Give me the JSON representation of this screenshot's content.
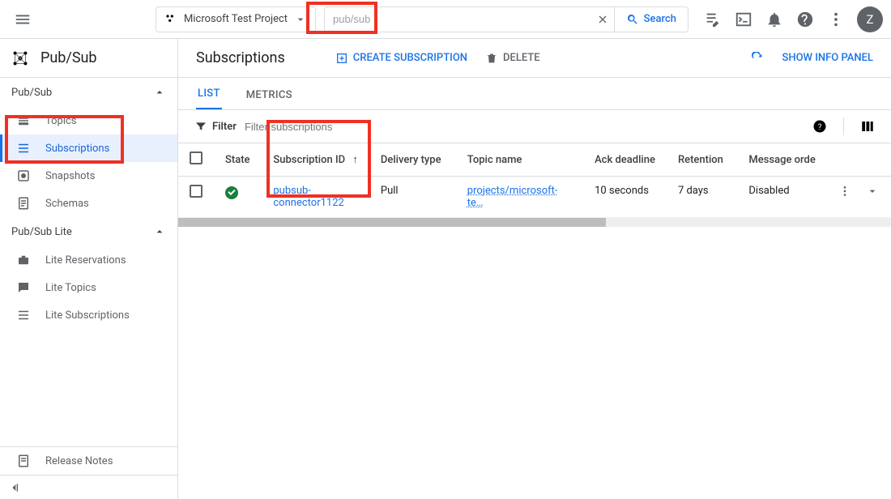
{
  "topbar": {
    "project_name": "Microsoft Test Project",
    "search_value": "pub/sub",
    "search_button": "Search",
    "avatar_initial": "Z"
  },
  "sidebar": {
    "product_title": "Pub/Sub",
    "sections": {
      "pubsub": {
        "label": "Pub/Sub"
      },
      "pubsub_lite": {
        "label": "Pub/Sub Lite"
      }
    },
    "items": {
      "topics": "Topics",
      "subscriptions": "Subscriptions",
      "snapshots": "Snapshots",
      "schemas": "Schemas",
      "lite_reservations": "Lite Reservations",
      "lite_topics": "Lite Topics",
      "lite_subscriptions": "Lite Subscriptions",
      "release_notes": "Release Notes"
    }
  },
  "main": {
    "page_title": "Subscriptions",
    "create_label": "CREATE SUBSCRIPTION",
    "delete_label": "DELETE",
    "show_info_panel": "SHOW INFO PANEL",
    "tabs": {
      "list": "LIST",
      "metrics": "METRICS"
    },
    "filter_label": "Filter",
    "filter_placeholder": "Filter subscriptions",
    "columns": {
      "state": "State",
      "subscription_id": "Subscription ID",
      "delivery_type": "Delivery type",
      "topic_name": "Topic name",
      "ack_deadline": "Ack deadline",
      "retention": "Retention",
      "message_ordering": "Message orde"
    },
    "rows": [
      {
        "subscription_id": "pubsub-connector1122",
        "delivery_type": "Pull",
        "topic_name": "projects/microsoft-te…",
        "ack_deadline": "10 seconds",
        "retention": "7 days",
        "message_ordering": "Disabled"
      }
    ]
  }
}
